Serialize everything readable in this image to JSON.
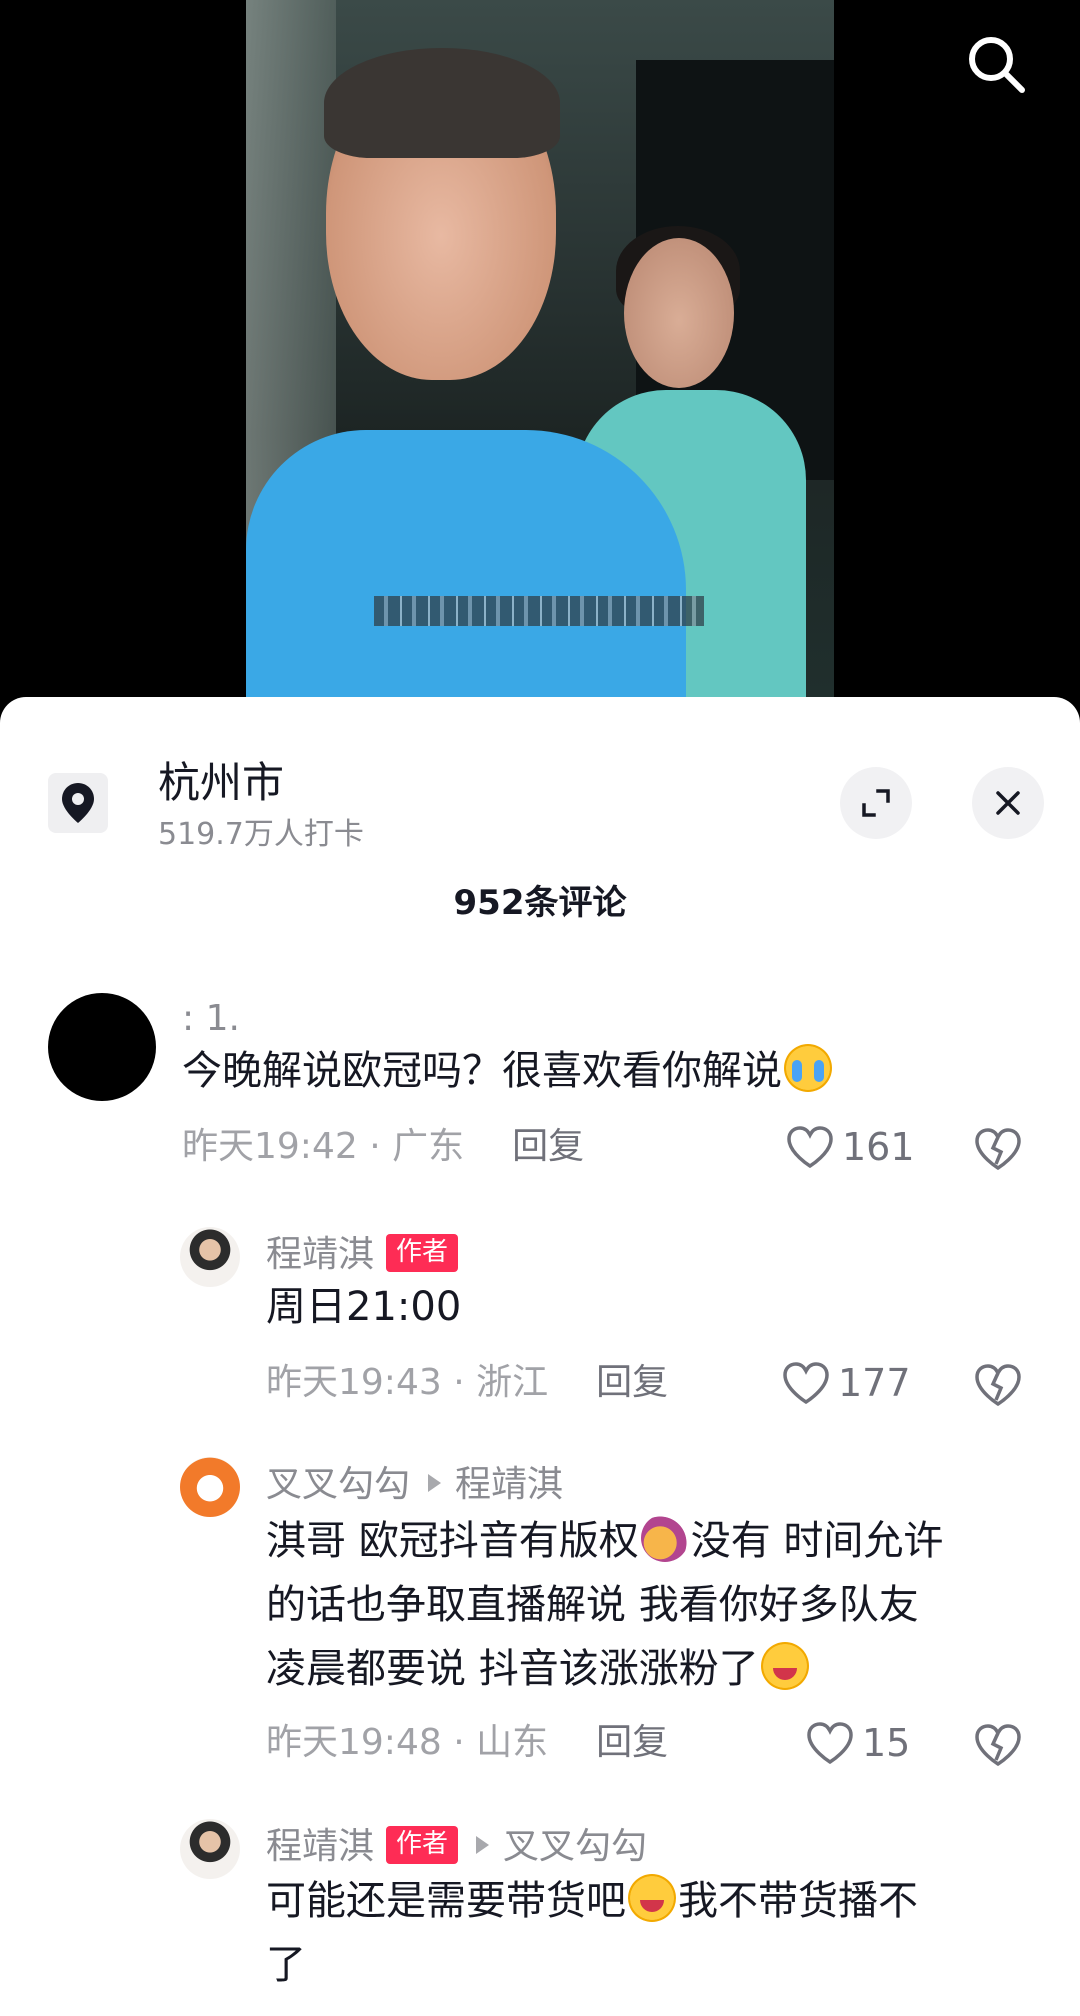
{
  "location": {
    "name": "杭州市",
    "checkins": "519.7万人打卡"
  },
  "comments_header": "952条评论",
  "comments": [
    {
      "username": ": 1.",
      "text": "今晚解说欧冠吗？很喜欢看你解说",
      "time_region": "昨天19:42 · 广东",
      "reply_label": "回复",
      "likes": "161"
    },
    {
      "username": "程靖淇",
      "author_tag": "作者",
      "text": "周日21:00",
      "time_region": "昨天19:43 · 浙江",
      "reply_label": "回复",
      "likes": "177"
    },
    {
      "username": "叉叉勾勾",
      "reply_to": "程靖淇",
      "text_1": "淇哥 欧冠抖音有版权",
      "text_2": "没有  时间允许",
      "text_3": "的话也争取直播解说 我看你好多队友",
      "text_4": "凌晨都要说 抖音该涨涨粉了",
      "time_region": "昨天19:48 · 山东",
      "reply_label": "回复",
      "likes": "15"
    },
    {
      "username": "程靖淇",
      "author_tag": "作者",
      "reply_to": "叉叉勾勾",
      "text_1": "可能还是需要带货吧",
      "text_2": "我不带货播不",
      "text_3": "了"
    }
  ],
  "icons": {
    "search": "search-icon",
    "location": "location-pin-icon",
    "expand": "expand-icon",
    "close": "close-icon",
    "like": "heart-icon",
    "dislike": "broken-heart-icon"
  },
  "colors": {
    "author_tag": "#fe2c55",
    "text_primary": "#161823",
    "text_secondary": "#8a8b91"
  }
}
